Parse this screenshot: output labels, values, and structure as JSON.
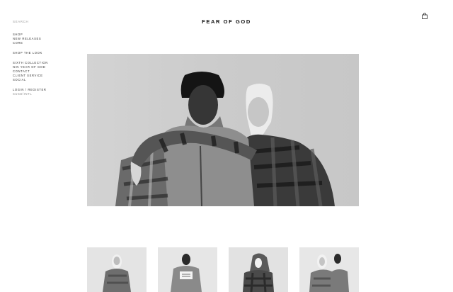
{
  "search": {
    "placeholder": "SEARCH"
  },
  "brand": {
    "logo": "FEAR OF GOD"
  },
  "nav": {
    "group1": [
      "SHOP",
      "NEW RELEASES",
      "CORE"
    ],
    "group2": [
      "SHOP THE LOOK"
    ],
    "group3": [
      "SIXTH COLLECTION",
      "NIN YEAR OF GOD",
      "CONTACT",
      "CLIENT SERVICE",
      "SOCIAL"
    ],
    "account": {
      "login": "LOGIN / REGISTER",
      "currency": "SUSD/INTL"
    }
  },
  "icons": {
    "cart": "shopping-bag-icon"
  },
  "colors": {
    "background": "#ffffff",
    "text": "#222222",
    "muted": "#9a9a9a"
  }
}
